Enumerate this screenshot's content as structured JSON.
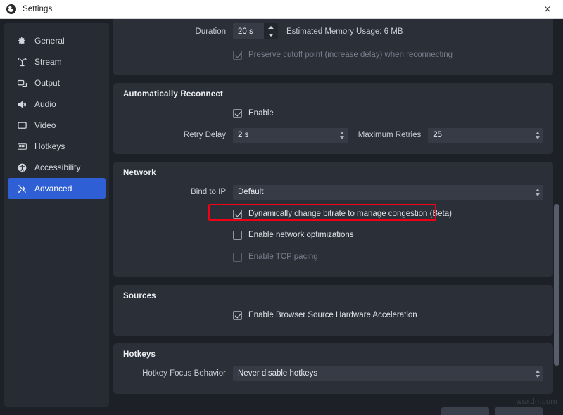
{
  "window": {
    "title": "Settings",
    "close_label": "×",
    "app_icon": "obs-icon",
    "watermark": "wsxdn.com"
  },
  "sidebar": {
    "items": [
      {
        "label": "General",
        "icon": "gear-icon",
        "active": false
      },
      {
        "label": "Stream",
        "icon": "broadcast-icon",
        "active": false
      },
      {
        "label": "Output",
        "icon": "monitor-icon",
        "active": false
      },
      {
        "label": "Audio",
        "icon": "speaker-icon",
        "active": false
      },
      {
        "label": "Video",
        "icon": "display-icon",
        "active": false
      },
      {
        "label": "Hotkeys",
        "icon": "keyboard-icon",
        "active": false
      },
      {
        "label": "Accessibility",
        "icon": "accessibility-icon",
        "active": false
      },
      {
        "label": "Advanced",
        "icon": "tools-icon",
        "active": true
      }
    ],
    "active_color": "#2f5fd4"
  },
  "sections": {
    "replay": {
      "duration_label": "Duration",
      "duration_value": "20 s",
      "memory_hint": "Estimated Memory Usage: 6 MB",
      "preserve_cutoff_label": "Preserve cutoff point (increase delay) when reconnecting",
      "preserve_cutoff_checked": true,
      "preserve_cutoff_disabled": true
    },
    "reconnect": {
      "title": "Automatically Reconnect",
      "enable_label": "Enable",
      "enable_checked": true,
      "retry_delay_label": "Retry Delay",
      "retry_delay_value": "2 s",
      "max_retries_label": "Maximum Retries",
      "max_retries_value": "25"
    },
    "network": {
      "title": "Network",
      "bind_ip_label": "Bind to IP",
      "bind_ip_value": "Default",
      "dynamic_bitrate_label": "Dynamically change bitrate to manage congestion (Beta)",
      "dynamic_bitrate_checked": true,
      "network_opt_label": "Enable network optimizations",
      "network_opt_checked": false,
      "tcp_pacing_label": "Enable TCP pacing",
      "tcp_pacing_checked": false,
      "tcp_pacing_disabled": true
    },
    "sources": {
      "title": "Sources",
      "browser_hwaccel_label": "Enable Browser Source Hardware Acceleration",
      "browser_hwaccel_checked": true
    },
    "hotkeys": {
      "title": "Hotkeys",
      "focus_behavior_label": "Hotkey Focus Behavior",
      "focus_behavior_value": "Never disable hotkeys"
    }
  },
  "annotation": {
    "color": "#f00014",
    "target": "dynamic-bitrate-checkbox-row"
  }
}
